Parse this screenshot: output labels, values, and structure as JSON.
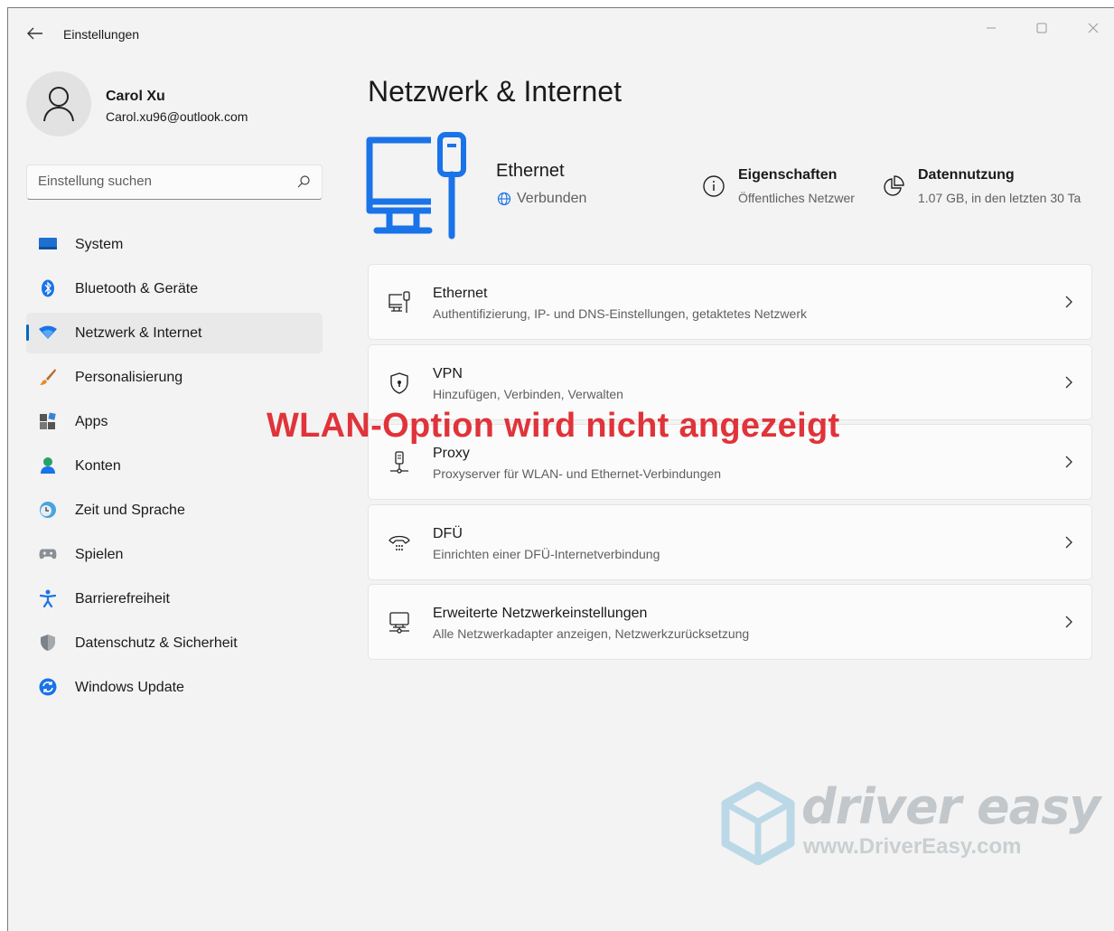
{
  "window": {
    "title": "Einstellungen"
  },
  "user": {
    "name": "Carol Xu",
    "email": "Carol.xu96@outlook.com"
  },
  "search": {
    "placeholder": "Einstellung suchen"
  },
  "sidebar": {
    "items": [
      {
        "label": "System",
        "icon": "system-icon",
        "active": false
      },
      {
        "label": "Bluetooth & Geräte",
        "icon": "bluetooth-icon",
        "active": false
      },
      {
        "label": "Netzwerk & Internet",
        "icon": "network-icon",
        "active": true
      },
      {
        "label": "Personalisierung",
        "icon": "brush-icon",
        "active": false
      },
      {
        "label": "Apps",
        "icon": "apps-icon",
        "active": false
      },
      {
        "label": "Konten",
        "icon": "account-icon",
        "active": false
      },
      {
        "label": "Zeit und Sprache",
        "icon": "clock-globe-icon",
        "active": false
      },
      {
        "label": "Spielen",
        "icon": "gamepad-icon",
        "active": false
      },
      {
        "label": "Barrierefreiheit",
        "icon": "accessibility-icon",
        "active": false
      },
      {
        "label": "Datenschutz & Sicherheit",
        "icon": "shield-icon",
        "active": false
      },
      {
        "label": "Windows Update",
        "icon": "update-icon",
        "active": false
      }
    ]
  },
  "main": {
    "title": "Netzwerk & Internet",
    "connection": {
      "name": "Ethernet",
      "status": "Verbunden"
    },
    "properties": {
      "title": "Eigenschaften",
      "subtitle": "Öffentliches Netzwer"
    },
    "data_usage": {
      "title": "Datennutzung",
      "subtitle": "1.07 GB, in den letzten 30 Ta"
    },
    "cards": [
      {
        "title": "Ethernet",
        "subtitle": "Authentifizierung, IP- und DNS-Einstellungen, getaktetes Netzwerk",
        "icon": "ethernet-icon"
      },
      {
        "title": "VPN",
        "subtitle": "Hinzufügen, Verbinden, Verwalten",
        "icon": "vpn-shield-icon"
      },
      {
        "title": "Proxy",
        "subtitle": "Proxyserver für WLAN- und Ethernet-Verbindungen",
        "icon": "proxy-icon"
      },
      {
        "title": "DFÜ",
        "subtitle": "Einrichten einer DFÜ-Internetverbindung",
        "icon": "dialup-icon"
      },
      {
        "title": "Erweiterte Netzwerkeinstellungen",
        "subtitle": "Alle Netzwerkadapter anzeigen, Netzwerkzurücksetzung",
        "icon": "advanced-network-icon"
      }
    ]
  },
  "overlay": {
    "text": "WLAN-Option wird nicht angezeigt",
    "color": "#e0333a"
  },
  "watermark": {
    "brand": "driver easy",
    "url": "www.DriverEasy.com"
  },
  "colors": {
    "accent": "#0067c0",
    "background": "#f3f3f3",
    "card": "#fbfbfb"
  }
}
